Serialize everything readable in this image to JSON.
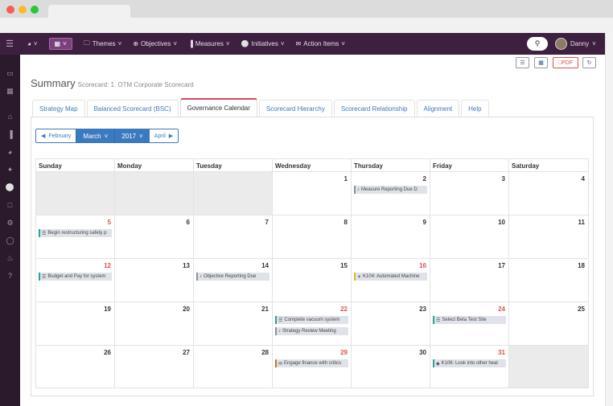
{
  "navbar": {
    "items": [
      {
        "label": "Themes",
        "icon": "folder-icon"
      },
      {
        "label": "Objectives",
        "icon": "crosshair-icon"
      },
      {
        "label": "Measures",
        "icon": "bar-chart-icon"
      },
      {
        "label": "Initiatives",
        "icon": "lightbulb-icon"
      },
      {
        "label": "Action Items",
        "icon": "envelope-icon"
      }
    ],
    "user": "Danny"
  },
  "toolbar": {
    "pdf_label": "PDF"
  },
  "page": {
    "title": "Summary",
    "subtitle": "Scorecard: 1. OTM Corporate Scorecard"
  },
  "tabs": [
    {
      "label": "Strategy Map"
    },
    {
      "label": "Balanced Scorecard (BSC)"
    },
    {
      "label": "Governance Calendar",
      "active": true
    },
    {
      "label": "Scorecard Hierarchy"
    },
    {
      "label": "Scorecard Relationship"
    },
    {
      "label": "Alignment"
    },
    {
      "label": "Help"
    }
  ],
  "monthnav": {
    "prev": "February",
    "month": "March",
    "year": "2017",
    "next": "April"
  },
  "calendar": {
    "weekdays": [
      "Sunday",
      "Monday",
      "Tuesday",
      "Wednesday",
      "Thursday",
      "Friday",
      "Saturday"
    ],
    "weeks": [
      [
        {
          "day": "",
          "empty": true
        },
        {
          "day": "",
          "empty": true
        },
        {
          "day": "",
          "empty": true
        },
        {
          "day": "1"
        },
        {
          "day": "2",
          "events": [
            {
              "label": "Measure Reporting Due D",
              "color": "grey",
              "icon": "bell-icon"
            }
          ]
        },
        {
          "day": "3"
        },
        {
          "day": "4"
        }
      ],
      [
        {
          "day": "5",
          "red": true,
          "events": [
            {
              "label": "Begin restructuring safety p",
              "color": "teal",
              "icon": "list-icon"
            }
          ]
        },
        {
          "day": "6"
        },
        {
          "day": "7"
        },
        {
          "day": "8"
        },
        {
          "day": "9"
        },
        {
          "day": "10"
        },
        {
          "day": "11"
        }
      ],
      [
        {
          "day": "12",
          "red": true,
          "events": [
            {
              "label": "Budget and Pay for system",
              "color": "teal",
              "icon": "list-icon"
            }
          ]
        },
        {
          "day": "13"
        },
        {
          "day": "14",
          "events": [
            {
              "label": "Objective Reporting Due",
              "color": "grey",
              "icon": "bell-icon"
            }
          ]
        },
        {
          "day": "15"
        },
        {
          "day": "16",
          "red": true,
          "events": [
            {
              "label": "K104: Automated Machine",
              "color": "yellow",
              "icon": "wrench-icon"
            }
          ]
        },
        {
          "day": "17"
        },
        {
          "day": "18"
        }
      ],
      [
        {
          "day": "19"
        },
        {
          "day": "20"
        },
        {
          "day": "21"
        },
        {
          "day": "22",
          "red": true,
          "events": [
            {
              "label": "Complete vacuum system",
              "color": "teal",
              "icon": "list-icon"
            },
            {
              "label": "Strategy Review Meeting",
              "color": "grey",
              "icon": "bell-icon"
            }
          ]
        },
        {
          "day": "23"
        },
        {
          "day": "24",
          "red": true,
          "events": [
            {
              "label": "Select Beta Test Site",
              "color": "teal",
              "icon": "list-icon"
            }
          ]
        },
        {
          "day": "25"
        }
      ],
      [
        {
          "day": "26"
        },
        {
          "day": "27"
        },
        {
          "day": "28"
        },
        {
          "day": "29",
          "red": true,
          "events": [
            {
              "label": "Engage finance with critics",
              "color": "orange",
              "icon": "envelope-icon"
            }
          ]
        },
        {
          "day": "30"
        },
        {
          "day": "31",
          "red": true,
          "events": [
            {
              "label": "K106: Look into other heal",
              "color": "teal",
              "icon": "diamond-icon"
            }
          ]
        },
        {
          "day": "",
          "empty": true
        }
      ]
    ]
  }
}
